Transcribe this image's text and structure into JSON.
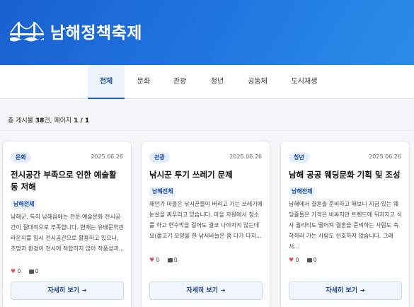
{
  "header": {
    "title": "남해정책축제",
    "logo_icon": "bridge-icon"
  },
  "tabs": [
    {
      "label": "전체",
      "active": true
    },
    {
      "label": "문화",
      "active": false
    },
    {
      "label": "관광",
      "active": false
    },
    {
      "label": "청년",
      "active": false
    },
    {
      "label": "공동체",
      "active": false
    },
    {
      "label": "도시재생",
      "active": false
    }
  ],
  "summary": {
    "prefix": "총 게시물 ",
    "count": "38",
    "middle": "건, 페이지 ",
    "page": "1 / 1"
  },
  "cards": [
    {
      "category": "문화",
      "date": "2025.06.26",
      "title": "전시공간 부족으로 인한 예술활동 저해",
      "region": "남해전체",
      "excerpt": "남해군, 특히 남해읍에는 전문 예술문화 전시공간이 절대적으로 부족합니다. 현재는 유배문학관 라운지를 임시 전시공간으로 활용하고 있으나, 조명과 환경이 전시에 적합하지 않아 작품성과...",
      "likes": "0",
      "comments": "0",
      "button": "자세히 보기"
    },
    {
      "category": "관광",
      "date": "2025.06.26",
      "title": "낚시꾼 투기 쓰레기 문제",
      "region": "남해전체",
      "excerpt": "해안가 마을은 낚시꾼들이 버리고 가는 쓰레기에 눈살을 찌푸리고 있습니다. 마을 자원에서 청소를 하고 현수막을 걸어도 결코 나아지지 않는데요(물고기 모양을 한 낚시바늘은 좀 다가 다치...",
      "likes": "0",
      "comments": "0",
      "button": "자세히 보기"
    },
    {
      "category": "청년",
      "date": "2025.06.26",
      "title": "남해 공공 웨딩문화 기획 및 조성",
      "region": "남해전체",
      "excerpt": "남해에서 결혼을 준비하고 해보니 지금 있는 웨딩홀들은 가격은 비싸지만 트렌드에 뒤처지고 식사 퀄리티도 떨어져 결혼을 준비하는 사람도 축하하러 가는 사람도 선호하지 않습니다. 그래서...",
      "likes": "0",
      "comments": "0",
      "button": "자세히 보기"
    }
  ],
  "colors": {
    "primary": "#1a56c7",
    "hero_start": "#1a5fd0",
    "hero_end": "#2a8ce8",
    "heart": "#e24b5d"
  }
}
